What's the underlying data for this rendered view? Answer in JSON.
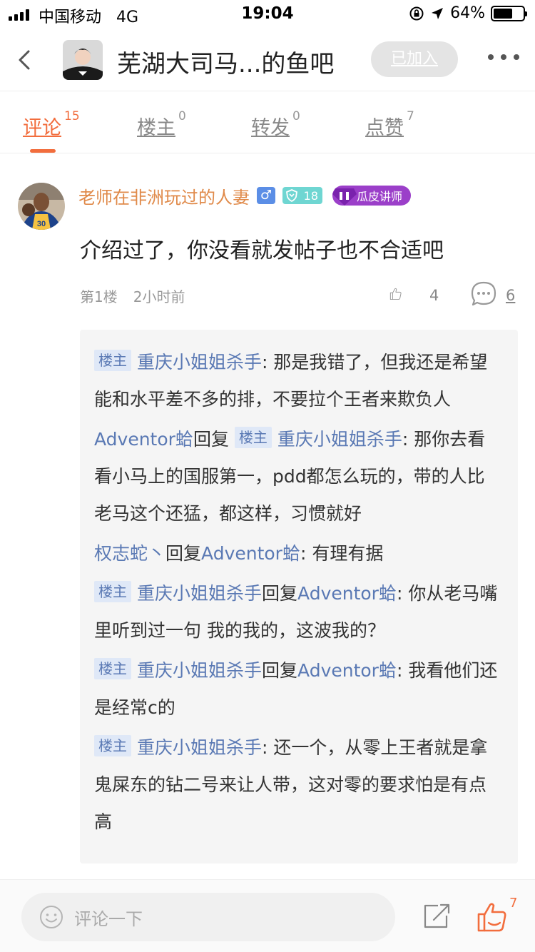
{
  "status_bar": {
    "carrier": "中国移动",
    "network": "4G",
    "time": "19:04",
    "battery": "64%",
    "battery_level": 0.64
  },
  "nav": {
    "title": "芜湖大司马...的鱼吧",
    "joined_label": "已加入"
  },
  "tabs": [
    {
      "label": "评论",
      "count": "15"
    },
    {
      "label": "楼主",
      "count": "0"
    },
    {
      "label": "转发",
      "count": "0"
    },
    {
      "label": "点赞",
      "count": "7"
    }
  ],
  "comment": {
    "username": "老师在非洲玩过的人妻",
    "gender_symbol": "♂",
    "level": "18",
    "badge": "瓜皮讲师",
    "text": "介绍过了，你没看就发帖子也不合适吧",
    "floor": "第1楼",
    "time_ago": "2小时前",
    "likes": "4",
    "replies": "6"
  },
  "reply_labels": {
    "host_badge": "楼主",
    "reply_word": "回复",
    "colon": ": "
  },
  "replies": [
    {
      "author": "重庆小姐姐杀手",
      "target": "",
      "text": "那是我错了，但我还是希望能和水平差不多的排，不要拉个王者来欺负人"
    },
    {
      "author": "Adventor蛤",
      "target": "重庆小姐姐杀手",
      "text": "那你去看看小马上的国服第一，pdd都怎么玩的，带的人比老马这个还猛，都这样，习惯就好"
    },
    {
      "author": "权志蛇丶",
      "target": "Adventor蛤",
      "text": "有理有据"
    },
    {
      "author": "重庆小姐姐杀手",
      "target": "Adventor蛤",
      "text": "你从老马嘴里听到过一句   我的我的，这波我的？"
    },
    {
      "author": "重庆小姐姐杀手",
      "target": "Adventor蛤",
      "text": "我看他们还是经常c的"
    },
    {
      "author": "重庆小姐姐杀手",
      "target": "",
      "text": "还一个，从零上王者就是拿鬼屎东的钻二号来让人带，这对零的要求怕是有点高"
    }
  ],
  "bottom_bar": {
    "placeholder": "评论一下",
    "like_count": "7"
  },
  "colors": {
    "accent": "#f26d3d",
    "username": "#e08a4a",
    "link_blue": "#5a79b4",
    "lecturer_purple": "#9b3fc9",
    "level_teal": "#6fd6d2"
  }
}
